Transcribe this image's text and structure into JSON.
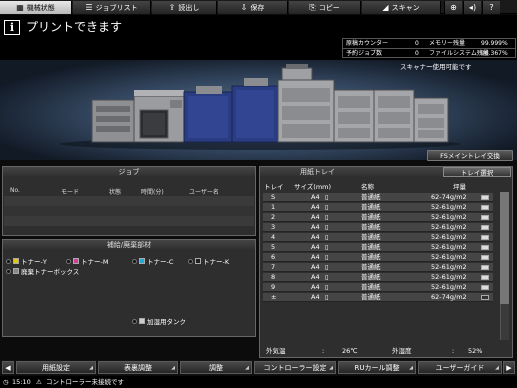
{
  "tabs": [
    {
      "label": "機械状態",
      "icon": "machine-status-icon",
      "active": true
    },
    {
      "label": "ジョブリスト",
      "icon": "job-list-icon"
    },
    {
      "label": "読出し",
      "icon": "recall-icon"
    },
    {
      "label": "保存",
      "icon": "store-icon"
    },
    {
      "label": "コピー",
      "icon": "copy-icon"
    },
    {
      "label": "スキャン",
      "icon": "scan-icon"
    }
  ],
  "top_icons": [
    "globe-icon",
    "volume-icon",
    "help-icon"
  ],
  "status": {
    "message": "プリントできます",
    "scanner_message": "スキャナー使用可能です"
  },
  "counters": {
    "original_counter_label": "原稿カウンター",
    "original_counter_value": "0",
    "memory_label": "メモリー残量",
    "memory_value": "99.999%",
    "reserved_jobs_label": "予約ジョブ数",
    "reserved_jobs_value": "0",
    "file_system_label": "ファイルシステム残量",
    "file_system_value": "96.367%"
  },
  "fs_main_tray_button": "FSメイントレイ交換",
  "job_panel": {
    "title": "ジョブ",
    "columns": [
      "No.",
      "モード",
      "状態",
      "時間(分)",
      "ユーザー名"
    ]
  },
  "supply_panel": {
    "title": "補給/廃棄部材",
    "items": [
      {
        "label": "トナー-Y",
        "color": "#e8c400"
      },
      {
        "label": "トナー-M",
        "color": "#d0409a"
      },
      {
        "label": "トナー-C",
        "color": "#20a8d8"
      },
      {
        "label": "トナー-K",
        "color": "#202020"
      },
      {
        "label": "廃棄トナーボックス",
        "color": "#888888"
      }
    ],
    "humidifier_tank": "加湿用タンク"
  },
  "tray_panel": {
    "title": "用紙トレイ",
    "select_button": "トレイ選択",
    "columns": [
      "トレイ",
      "サイズ(mm)",
      "名称",
      "坪量"
    ],
    "rows": [
      {
        "tray": "S",
        "size": "A4",
        "name": "普通紙",
        "weight": "62-74g/m2",
        "full": true
      },
      {
        "tray": "1",
        "size": "A4",
        "name": "普通紙",
        "weight": "52-61g/m2",
        "full": true
      },
      {
        "tray": "2",
        "size": "A4",
        "name": "普通紙",
        "weight": "52-61g/m2",
        "full": true
      },
      {
        "tray": "3",
        "size": "A4",
        "name": "普通紙",
        "weight": "52-61g/m2",
        "full": true
      },
      {
        "tray": "4",
        "size": "A4",
        "name": "普通紙",
        "weight": "52-61g/m2",
        "full": true
      },
      {
        "tray": "5",
        "size": "A4",
        "name": "普通紙",
        "weight": "52-61g/m2",
        "full": true
      },
      {
        "tray": "6",
        "size": "A4",
        "name": "普通紙",
        "weight": "52-61g/m2",
        "full": true
      },
      {
        "tray": "7",
        "size": "A4",
        "name": "普通紙",
        "weight": "52-61g/m2",
        "full": true
      },
      {
        "tray": "8",
        "size": "A4",
        "name": "普通紙",
        "weight": "52-61g/m2",
        "full": true
      },
      {
        "tray": "9",
        "size": "A4",
        "name": "普通紙",
        "weight": "52-61g/m2",
        "full": true
      },
      {
        "tray": "±",
        "size": "A4",
        "name": "普通紙",
        "weight": "62-74g/m2",
        "full": false
      }
    ],
    "outside_temp_label": "外気温",
    "outside_temp_value": "26℃",
    "outside_humidity_label": "外湿度",
    "outside_humidity_value": "52%"
  },
  "bottom_buttons": [
    "用紙設定",
    "表裏調整",
    "調整",
    "コントローラー設定",
    "RUカール調整",
    "ユーザーガイド"
  ],
  "statusbar": {
    "time": "15:10",
    "message": "コントローラー未接続です"
  }
}
